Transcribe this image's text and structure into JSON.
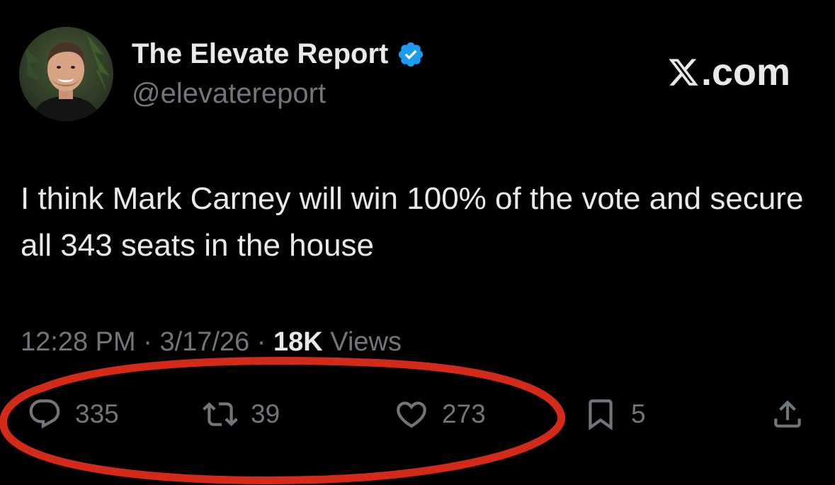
{
  "author": {
    "display_name": "The Elevate Report",
    "handle": "@elevatereport",
    "verified": true,
    "verified_color": "#1d9bf0"
  },
  "watermark": {
    "text": ".com",
    "logo_icon": "x-logo-icon"
  },
  "tweet": {
    "text": "I think Mark Carney will win 100% of the vote and secure all 343 seats in the house"
  },
  "meta": {
    "time": "12:28 PM",
    "separator": "·",
    "date": "3/17/26",
    "views_count": "18K",
    "views_label": "Views"
  },
  "actions": {
    "replies": {
      "icon": "reply-icon",
      "count": "335"
    },
    "reposts": {
      "icon": "repost-icon",
      "count": "39"
    },
    "likes": {
      "icon": "heart-icon",
      "count": "273"
    },
    "bookmarks": {
      "icon": "bookmark-icon",
      "count": "5"
    },
    "share": {
      "icon": "share-icon"
    }
  },
  "colors": {
    "background": "#000000",
    "primary_text": "#e7e9ea",
    "secondary_text": "#71767b",
    "annotation": "#d42a1a"
  }
}
